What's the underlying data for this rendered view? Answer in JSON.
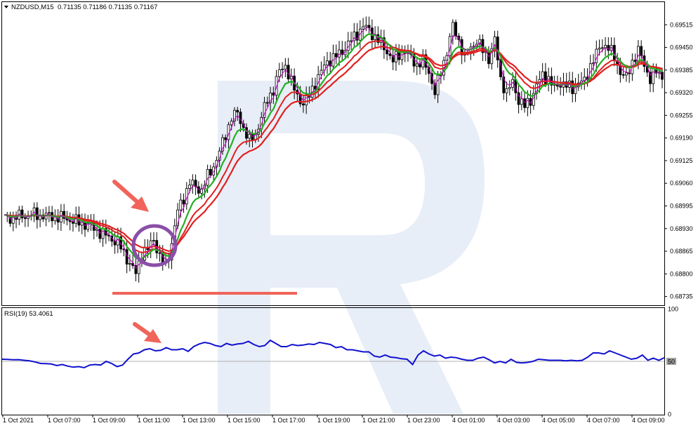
{
  "header": {
    "symbol": "NZDUSD,M15",
    "ohlc": "0.71135 0.71186 0.71135 0.71167"
  },
  "indicator": {
    "label": "RSI(19) 53.4061",
    "levels": [
      "100",
      "50",
      "0"
    ]
  },
  "colors": {
    "candle": "#000000",
    "ma_fast": "#c000c0",
    "ma_green": "#22b022",
    "ma_red": "#e02020",
    "rsi": "#1010d0",
    "annotation": "#f0645a",
    "circle": "#8a4fa8",
    "watermark": "#e6ecf5"
  },
  "chart_data": [
    {
      "type": "candlestick",
      "title": "NZDUSD,M15",
      "y_ticks": [
        "0.69515",
        "0.69450",
        "0.69385",
        "0.69320",
        "0.69255",
        "0.69190",
        "0.69125",
        "0.69060",
        "0.68995",
        "0.68930",
        "0.68865",
        "0.68800",
        "0.68735"
      ],
      "ylim": [
        0.6871,
        0.6958
      ],
      "x_ticks": [
        "1 Oct 2021",
        "1 Oct 07:00",
        "1 Oct 09:00",
        "1 Oct 11:00",
        "1 Oct 13:00",
        "1 Oct 15:00",
        "1 Oct 17:00",
        "1 Oct 19:00",
        "1 Oct 21:00",
        "1 Oct 23:00",
        "4 Oct 01:00",
        "4 Oct 03:00",
        "4 Oct 05:00",
        "4 Oct 07:00",
        "4 Oct 09:00"
      ],
      "close_path": [
        [
          0,
          0.6896
        ],
        [
          10,
          0.6897
        ],
        [
          20,
          0.6896
        ],
        [
          28,
          0.6894
        ],
        [
          34,
          0.6891
        ],
        [
          38,
          0.6889
        ],
        [
          40,
          0.6886
        ],
        [
          42,
          0.6883
        ],
        [
          44,
          0.688
        ],
        [
          46,
          0.6886
        ],
        [
          48,
          0.6887
        ],
        [
          50,
          0.689
        ],
        [
          52,
          0.6885
        ],
        [
          54,
          0.6882
        ],
        [
          56,
          0.6889
        ],
        [
          58,
          0.6898
        ],
        [
          60,
          0.6902
        ],
        [
          62,
          0.6906
        ],
        [
          64,
          0.6905
        ],
        [
          66,
          0.6904
        ],
        [
          68,
          0.6908
        ],
        [
          70,
          0.6911
        ],
        [
          72,
          0.6915
        ],
        [
          74,
          0.692
        ],
        [
          76,
          0.6925
        ],
        [
          78,
          0.6926
        ],
        [
          80,
          0.6922
        ],
        [
          82,
          0.6918
        ],
        [
          84,
          0.692
        ],
        [
          86,
          0.6925
        ],
        [
          88,
          0.693
        ],
        [
          90,
          0.6933
        ],
        [
          92,
          0.6938
        ],
        [
          94,
          0.694
        ],
        [
          96,
          0.6935
        ],
        [
          98,
          0.6931
        ],
        [
          100,
          0.6929
        ],
        [
          102,
          0.6931
        ],
        [
          104,
          0.6935
        ],
        [
          106,
          0.6938
        ],
        [
          108,
          0.6941
        ],
        [
          110,
          0.6942
        ],
        [
          112,
          0.6943
        ],
        [
          114,
          0.6945
        ],
        [
          116,
          0.6947
        ],
        [
          118,
          0.6949
        ],
        [
          120,
          0.6951
        ],
        [
          122,
          0.695
        ],
        [
          124,
          0.6948
        ],
        [
          126,
          0.6946
        ],
        [
          128,
          0.6944
        ],
        [
          130,
          0.6941
        ],
        [
          132,
          0.6943
        ],
        [
          134,
          0.6944
        ],
        [
          136,
          0.6942
        ],
        [
          138,
          0.694
        ],
        [
          140,
          0.6941
        ],
        [
          142,
          0.6938
        ],
        [
          144,
          0.6932
        ],
        [
          146,
          0.6938
        ],
        [
          148,
          0.6944
        ],
        [
          150,
          0.6951
        ],
        [
          152,
          0.6947
        ],
        [
          154,
          0.6942
        ],
        [
          156,
          0.6945
        ],
        [
          158,
          0.6947
        ],
        [
          160,
          0.6944
        ],
        [
          162,
          0.6942
        ],
        [
          164,
          0.6947
        ],
        [
          166,
          0.6936
        ],
        [
          168,
          0.6932
        ],
        [
          170,
          0.6935
        ],
        [
          172,
          0.693
        ],
        [
          174,
          0.6928
        ],
        [
          176,
          0.693
        ],
        [
          178,
          0.6934
        ],
        [
          180,
          0.6937
        ],
        [
          182,
          0.6936
        ],
        [
          184,
          0.6933
        ],
        [
          186,
          0.6935
        ],
        [
          188,
          0.6934
        ],
        [
          190,
          0.6933
        ],
        [
          192,
          0.6935
        ],
        [
          194,
          0.6935
        ],
        [
          196,
          0.694
        ],
        [
          198,
          0.6943
        ],
        [
          200,
          0.6946
        ],
        [
          202,
          0.6945
        ],
        [
          204,
          0.6942
        ],
        [
          206,
          0.6938
        ],
        [
          208,
          0.6936
        ],
        [
          210,
          0.6941
        ],
        [
          212,
          0.6944
        ],
        [
          214,
          0.694
        ],
        [
          216,
          0.6936
        ],
        [
          218,
          0.6938
        ],
        [
          220,
          0.6937
        ]
      ],
      "series": [
        {
          "name": "MA fast",
          "values_note": "smoothed close"
        },
        {
          "name": "MA green"
        },
        {
          "name": "MA red 1"
        },
        {
          "name": "MA red 2"
        }
      ]
    },
    {
      "type": "line",
      "title": "RSI(19) 53.4061",
      "ylim": [
        0,
        100
      ],
      "levels": [
        50
      ],
      "values": [
        52,
        51.8,
        51.5,
        51.6,
        51,
        50.5,
        49.5,
        48,
        47.8,
        47.5,
        46,
        47,
        45.5,
        44.5,
        45,
        44,
        46.5,
        47,
        46.5,
        50,
        48,
        45,
        46.5,
        52,
        57,
        58,
        61,
        62,
        60,
        60.5,
        63,
        61,
        61,
        62,
        59.5,
        64,
        66.5,
        68,
        67,
        65,
        64,
        67,
        65.5,
        66.5,
        67,
        69,
        66,
        64,
        65,
        70,
        67,
        64,
        64,
        66,
        65,
        65.5,
        66.5,
        66,
        68,
        67,
        66,
        63,
        64,
        61,
        61,
        60,
        59,
        59,
        55,
        54,
        56,
        54,
        53.5,
        52.5,
        52,
        47,
        56,
        60,
        57,
        55,
        56,
        53,
        54,
        53.5,
        52,
        51,
        51,
        53,
        54,
        51.5,
        48.5,
        50,
        48.5,
        52,
        49,
        48.5,
        49,
        50,
        52,
        51.5,
        51,
        51,
        51,
        50.5,
        51,
        50.5,
        51,
        54,
        58,
        58,
        57,
        60,
        58,
        56,
        54,
        52,
        53,
        56,
        51,
        53,
        51,
        53.4
      ]
    }
  ]
}
